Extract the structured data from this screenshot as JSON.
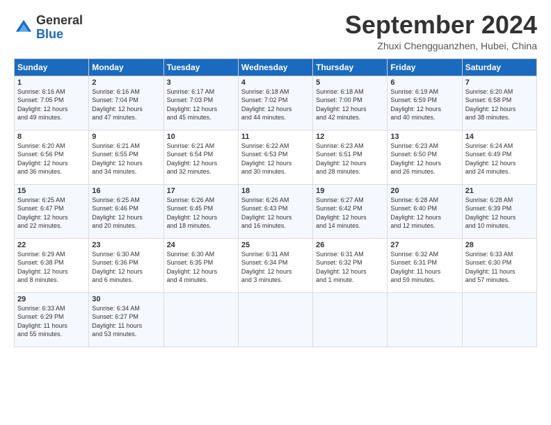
{
  "header": {
    "logo_general": "General",
    "logo_blue": "Blue",
    "title": "September 2024",
    "subtitle": "Zhuxi Chengguanzhen, Hubei, China"
  },
  "days_of_week": [
    "Sunday",
    "Monday",
    "Tuesday",
    "Wednesday",
    "Thursday",
    "Friday",
    "Saturday"
  ],
  "weeks": [
    [
      {
        "day": "1",
        "info": "Sunrise: 6:16 AM\nSunset: 7:05 PM\nDaylight: 12 hours\nand 49 minutes."
      },
      {
        "day": "2",
        "info": "Sunrise: 6:16 AM\nSunset: 7:04 PM\nDaylight: 12 hours\nand 47 minutes."
      },
      {
        "day": "3",
        "info": "Sunrise: 6:17 AM\nSunset: 7:03 PM\nDaylight: 12 hours\nand 45 minutes."
      },
      {
        "day": "4",
        "info": "Sunrise: 6:18 AM\nSunset: 7:02 PM\nDaylight: 12 hours\nand 44 minutes."
      },
      {
        "day": "5",
        "info": "Sunrise: 6:18 AM\nSunset: 7:00 PM\nDaylight: 12 hours\nand 42 minutes."
      },
      {
        "day": "6",
        "info": "Sunrise: 6:19 AM\nSunset: 6:59 PM\nDaylight: 12 hours\nand 40 minutes."
      },
      {
        "day": "7",
        "info": "Sunrise: 6:20 AM\nSunset: 6:58 PM\nDaylight: 12 hours\nand 38 minutes."
      }
    ],
    [
      {
        "day": "8",
        "info": "Sunrise: 6:20 AM\nSunset: 6:56 PM\nDaylight: 12 hours\nand 36 minutes."
      },
      {
        "day": "9",
        "info": "Sunrise: 6:21 AM\nSunset: 6:55 PM\nDaylight: 12 hours\nand 34 minutes."
      },
      {
        "day": "10",
        "info": "Sunrise: 6:21 AM\nSunset: 6:54 PM\nDaylight: 12 hours\nand 32 minutes."
      },
      {
        "day": "11",
        "info": "Sunrise: 6:22 AM\nSunset: 6:53 PM\nDaylight: 12 hours\nand 30 minutes."
      },
      {
        "day": "12",
        "info": "Sunrise: 6:23 AM\nSunset: 6:51 PM\nDaylight: 12 hours\nand 28 minutes."
      },
      {
        "day": "13",
        "info": "Sunrise: 6:23 AM\nSunset: 6:50 PM\nDaylight: 12 hours\nand 26 minutes."
      },
      {
        "day": "14",
        "info": "Sunrise: 6:24 AM\nSunset: 6:49 PM\nDaylight: 12 hours\nand 24 minutes."
      }
    ],
    [
      {
        "day": "15",
        "info": "Sunrise: 6:25 AM\nSunset: 6:47 PM\nDaylight: 12 hours\nand 22 minutes."
      },
      {
        "day": "16",
        "info": "Sunrise: 6:25 AM\nSunset: 6:46 PM\nDaylight: 12 hours\nand 20 minutes."
      },
      {
        "day": "17",
        "info": "Sunrise: 6:26 AM\nSunset: 6:45 PM\nDaylight: 12 hours\nand 18 minutes."
      },
      {
        "day": "18",
        "info": "Sunrise: 6:26 AM\nSunset: 6:43 PM\nDaylight: 12 hours\nand 16 minutes."
      },
      {
        "day": "19",
        "info": "Sunrise: 6:27 AM\nSunset: 6:42 PM\nDaylight: 12 hours\nand 14 minutes."
      },
      {
        "day": "20",
        "info": "Sunrise: 6:28 AM\nSunset: 6:40 PM\nDaylight: 12 hours\nand 12 minutes."
      },
      {
        "day": "21",
        "info": "Sunrise: 6:28 AM\nSunset: 6:39 PM\nDaylight: 12 hours\nand 10 minutes."
      }
    ],
    [
      {
        "day": "22",
        "info": "Sunrise: 6:29 AM\nSunset: 6:38 PM\nDaylight: 12 hours\nand 8 minutes."
      },
      {
        "day": "23",
        "info": "Sunrise: 6:30 AM\nSunset: 6:36 PM\nDaylight: 12 hours\nand 6 minutes."
      },
      {
        "day": "24",
        "info": "Sunrise: 6:30 AM\nSunset: 6:35 PM\nDaylight: 12 hours\nand 4 minutes."
      },
      {
        "day": "25",
        "info": "Sunrise: 6:31 AM\nSunset: 6:34 PM\nDaylight: 12 hours\nand 3 minutes."
      },
      {
        "day": "26",
        "info": "Sunrise: 6:31 AM\nSunset: 6:32 PM\nDaylight: 12 hours\nand 1 minute."
      },
      {
        "day": "27",
        "info": "Sunrise: 6:32 AM\nSunset: 6:31 PM\nDaylight: 11 hours\nand 59 minutes."
      },
      {
        "day": "28",
        "info": "Sunrise: 6:33 AM\nSunset: 6:30 PM\nDaylight: 11 hours\nand 57 minutes."
      }
    ],
    [
      {
        "day": "29",
        "info": "Sunrise: 6:33 AM\nSunset: 6:29 PM\nDaylight: 11 hours\nand 55 minutes."
      },
      {
        "day": "30",
        "info": "Sunrise: 6:34 AM\nSunset: 6:27 PM\nDaylight: 11 hours\nand 53 minutes."
      },
      {
        "day": "",
        "info": ""
      },
      {
        "day": "",
        "info": ""
      },
      {
        "day": "",
        "info": ""
      },
      {
        "day": "",
        "info": ""
      },
      {
        "day": "",
        "info": ""
      }
    ]
  ]
}
